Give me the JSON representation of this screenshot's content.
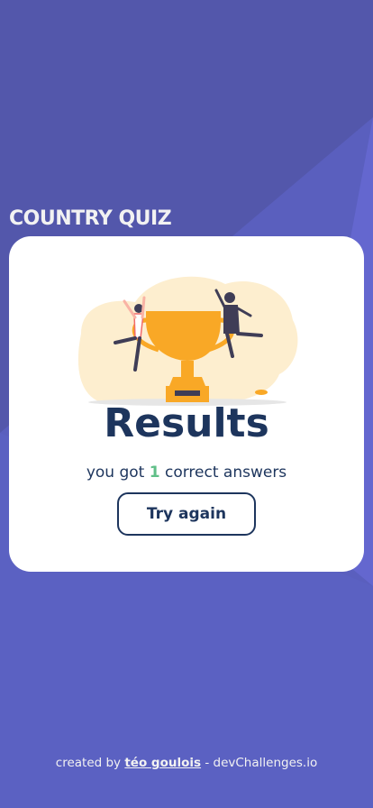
{
  "app": {
    "title": "COUNTRY QUIZ"
  },
  "results": {
    "heading": "Results",
    "prefix": "you got ",
    "score": "1",
    "suffix": " correct answers",
    "button_label": "Try again"
  },
  "footer": {
    "created_by": "created by ",
    "author": "téo goulois",
    "separator": " - ",
    "site": "devChallenges.io"
  },
  "colors": {
    "background": "#5a5fbe",
    "card": "#ffffff",
    "heading": "#1d355d",
    "score": "#60bf88",
    "trophy": "#f9a826"
  }
}
